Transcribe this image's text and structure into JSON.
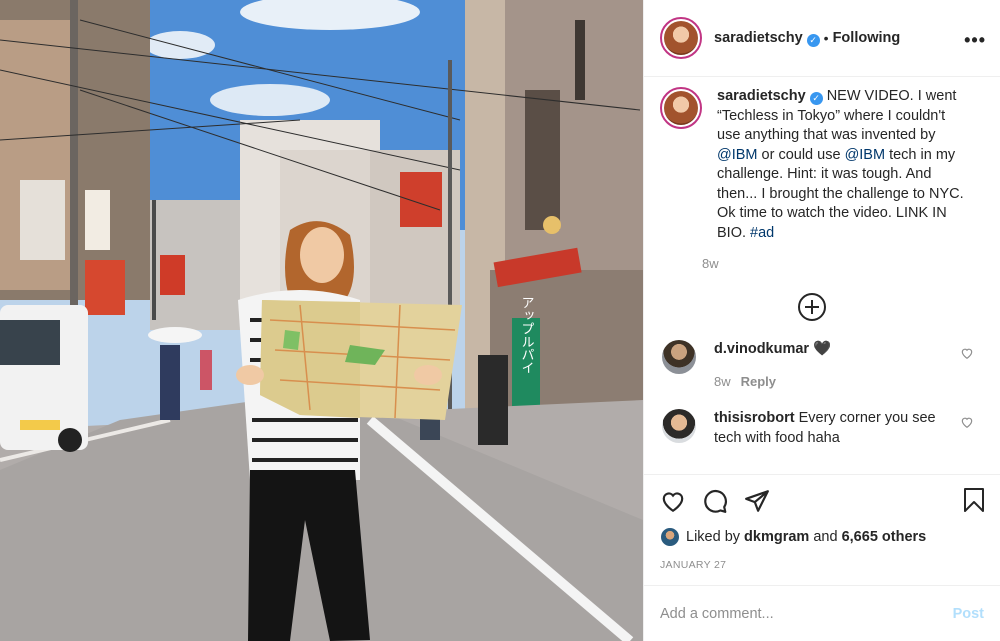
{
  "photo": {
    "sign_text": "アップルパイ",
    "alt_icon": "street-photo"
  },
  "header": {
    "username": "saradietschy",
    "verified": "✓",
    "separator": "•",
    "follow_status": "Following",
    "more": "•••"
  },
  "caption": {
    "username": "saradietschy",
    "part1": "NEW VIDEO. I went “Techless in Tokyo” where I couldn't use anything that was invented by ",
    "mention1": "@IBM",
    "part2": " or could use ",
    "mention2": "@IBM",
    "part3": " tech in my challenge. Hint: it was tough. And then... I brought the challenge to NYC. Ok time to watch the video. LINK IN BIO. ",
    "hashtag": "#ad",
    "time": "8w"
  },
  "comments": [
    {
      "username": "d.vinodkumar",
      "text": "🖤",
      "time": "8w",
      "reply": "Reply"
    },
    {
      "username": "thisisrobort",
      "text": "Every corner you see tech with food haha"
    }
  ],
  "likes": {
    "prefix": "Liked by",
    "user": "dkmgram",
    "conj": "and",
    "others": "6,665 others"
  },
  "date": "JANUARY 27",
  "add_comment": {
    "placeholder": "Add a comment...",
    "post_label": "Post"
  },
  "colors": {
    "link": "#00376b",
    "verified": "#3897f0",
    "muted": "#8e8e8e",
    "post_disabled": "#b2dffc"
  }
}
